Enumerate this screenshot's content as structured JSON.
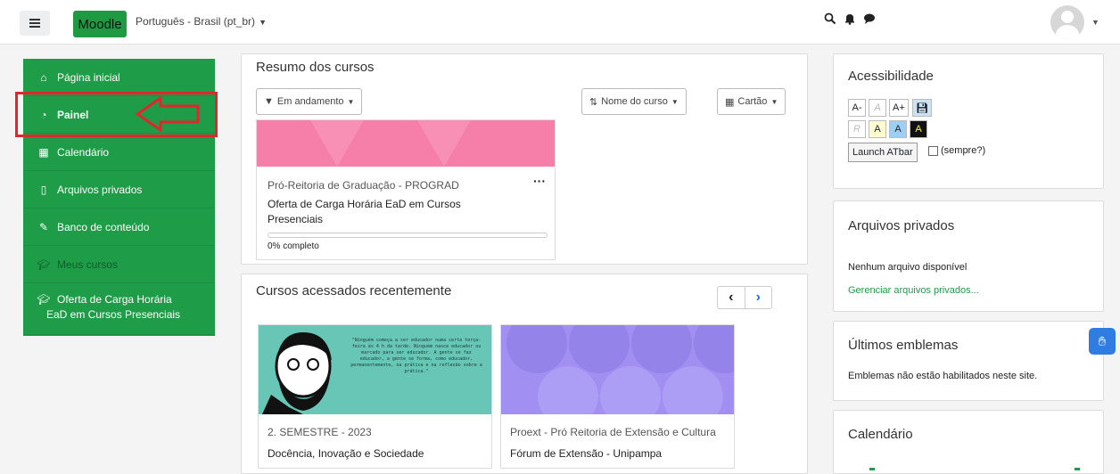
{
  "header": {
    "brand": "Moodle",
    "language": "Português - Brasil (pt_br)",
    "icons": [
      "search-icon",
      "bell-icon",
      "chat-icon",
      "user-avatar"
    ]
  },
  "sidebar": {
    "items": [
      {
        "label": "Página inicial",
        "icon": "home-icon"
      },
      {
        "label": "Painel",
        "icon": "dashboard-icon"
      },
      {
        "label": "Calendário",
        "icon": "calendar-icon"
      },
      {
        "label": "Arquivos privados",
        "icon": "file-icon"
      },
      {
        "label": "Banco de conteúdo",
        "icon": "pencil-icon"
      },
      {
        "label": "Meus cursos",
        "icon": "graduation-cap-icon"
      }
    ],
    "course": {
      "line1": "Oferta de Carga Horária",
      "line2": "EaD em Cursos Presenciais"
    }
  },
  "overview": {
    "title": "Resumo dos cursos",
    "filter": "Em andamento",
    "sort": "Nome do curso",
    "view": "Cartão",
    "course": {
      "category": "Pró-Reitoria de Graduação - PROGRAD",
      "name_line1": "Oferta de Carga Horária EaD em Cursos",
      "name_line2": "Presenciais",
      "progress": "0% completo",
      "progress_value": 0
    }
  },
  "recent": {
    "title": "Cursos acessados recentemente",
    "quote": "\"Ninguém começa a ser educador numa certa terça-feira às 4 h da tarde. Ninguém nasce educador ou marcado para ser educador. A gente se faz educador, a gente se forma, como educador, permanentemente, na prática e na reflexão sobre a prática.\"",
    "courses": [
      {
        "category": "2. SEMESTRE - 2023",
        "name": "Docência, Inovação e Sociedade"
      },
      {
        "category": "Proext - Pró Reitoria de Extensão e Cultura",
        "name": "Fórum de Extensão - Unipampa"
      }
    ]
  },
  "accessibility": {
    "title": "Acessibilidade",
    "row1": [
      "A-",
      "A",
      "A+"
    ],
    "row2": [
      "R",
      "A",
      "A",
      "A"
    ],
    "launch": "Launch ATbar",
    "always": "(sempre?)"
  },
  "private_files": {
    "title": "Arquivos privados",
    "empty": "Nenhum arquivo disponível",
    "manage": "Gerenciar arquivos privados..."
  },
  "badges": {
    "title": "Últimos emblemas",
    "text": "Emblemas não estão habilitados neste site."
  },
  "calendar": {
    "title": "Calendário"
  },
  "colors": {
    "brand_green": "#1e9c47",
    "highlight_red": "#e3262b",
    "pink_banner": "#f57fa9",
    "purple_banner": "#a18ff2"
  }
}
